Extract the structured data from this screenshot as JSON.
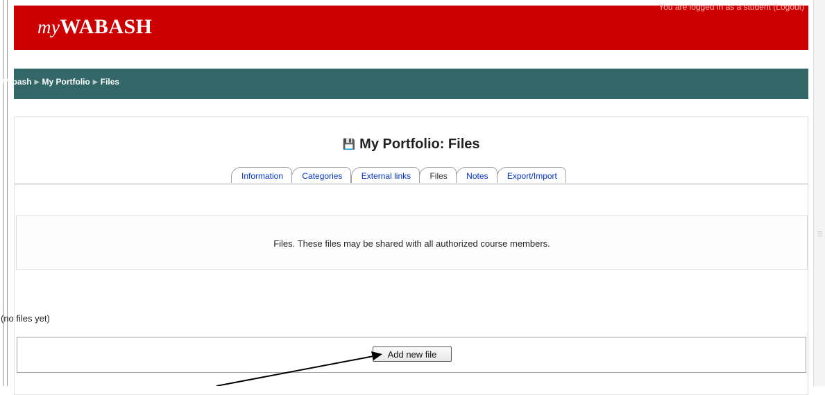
{
  "header": {
    "logo_prefix": "my",
    "logo_main": "WABASH",
    "login_text": "You are logged in as a student",
    "logout_label": "(Logout)",
    "brand_color": "#cc0000"
  },
  "breadcrumb": {
    "items": [
      "Wabash",
      "My Portfolio",
      "Files"
    ],
    "separator_icon": "triangle-right-icon",
    "bar_color": "#336666"
  },
  "main": {
    "title_icon": "floppy-disk-icon",
    "title": "My Portfolio: Files",
    "tabs": [
      {
        "label": "Information",
        "active": false
      },
      {
        "label": "Categories",
        "active": false
      },
      {
        "label": "External links",
        "active": false
      },
      {
        "label": "Files",
        "active": true
      },
      {
        "label": "Notes",
        "active": false
      },
      {
        "label": "Export/Import",
        "active": false
      }
    ],
    "info_text": "Files. These files may be shared with all authorized course members.",
    "empty_text": "(no files yet)",
    "add_button_label": "Add new file"
  }
}
